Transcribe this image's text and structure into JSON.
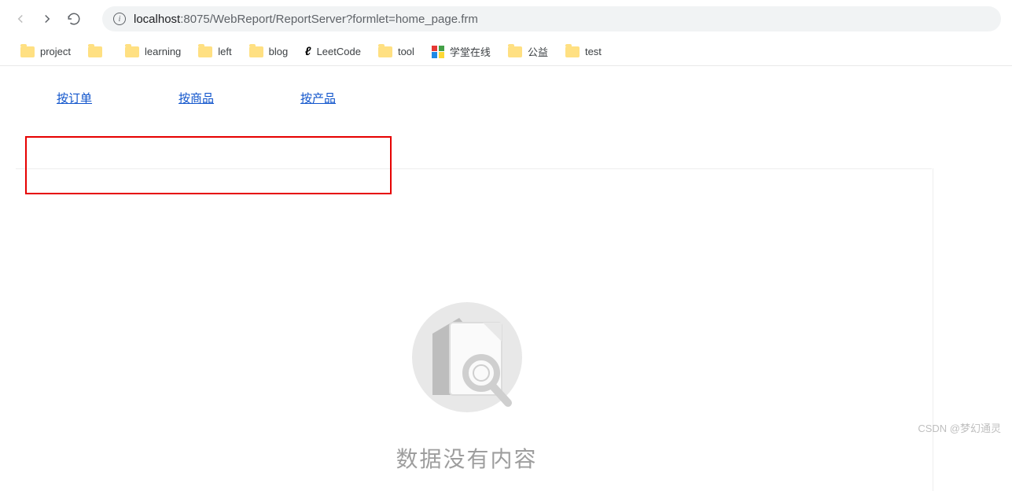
{
  "browser": {
    "url_host": "localhost",
    "url_rest": ":8075/WebReport/ReportServer?formlet=home_page.frm"
  },
  "bookmarks": [
    {
      "kind": "folder",
      "label": "project"
    },
    {
      "kind": "folder",
      "label": ""
    },
    {
      "kind": "folder",
      "label": "learning"
    },
    {
      "kind": "folder",
      "label": "left"
    },
    {
      "kind": "folder",
      "label": "blog"
    },
    {
      "kind": "leetcode",
      "label": "LeetCode"
    },
    {
      "kind": "folder",
      "label": "tool"
    },
    {
      "kind": "xuetang",
      "label": "学堂在线"
    },
    {
      "kind": "folder",
      "label": "公益"
    },
    {
      "kind": "folder",
      "label": "test"
    }
  ],
  "tabs": [
    {
      "label": "按订单"
    },
    {
      "label": "按商品"
    },
    {
      "label": "按产品"
    }
  ],
  "empty_state": {
    "message": "数据没有内容"
  },
  "watermark": "CSDN @梦幻通灵"
}
